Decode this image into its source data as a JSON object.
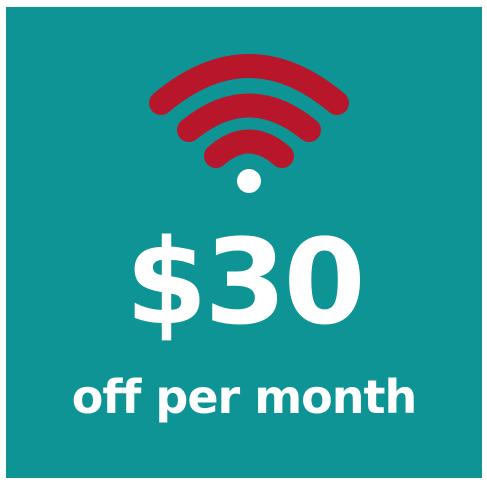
{
  "offer": {
    "amount": "$30",
    "period_text": "off per month"
  },
  "icon": {
    "name": "wifi-icon"
  },
  "colors": {
    "background": "#0e9494",
    "icon_arcs": "#b8162a",
    "icon_dot": "#ffffff",
    "text": "#ffffff"
  }
}
